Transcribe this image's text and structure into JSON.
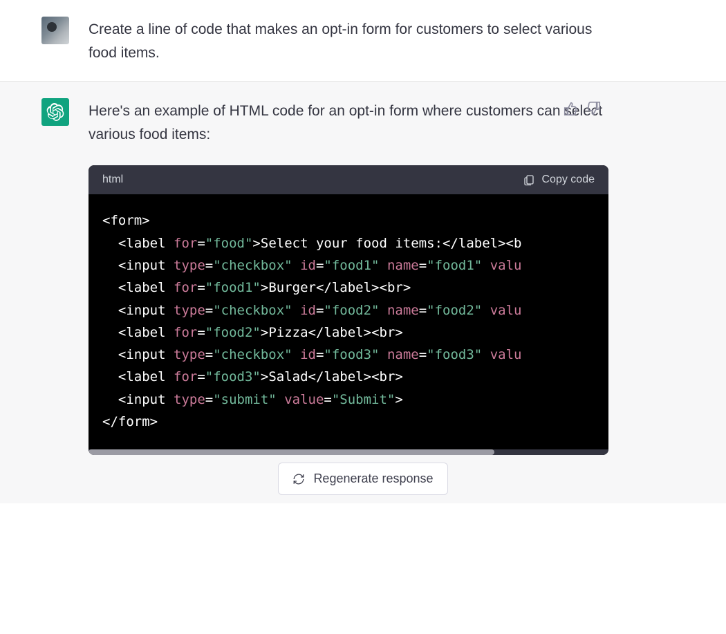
{
  "user_message": "Create a line of code that makes an opt-in form for customers to select various food items.",
  "assistant_intro": "Here's an example of HTML code for an opt-in form where customers can select various food items:",
  "code_lang_label": "html",
  "copy_label": "Copy code",
  "regenerate_label": "Regenerate response",
  "feedback_up_icon": "thumb-up",
  "feedback_down_icon": "thumb-down",
  "code_lines": [
    {
      "indent": 0,
      "parts": [
        {
          "t": "punc",
          "v": "<"
        },
        {
          "t": "tag",
          "v": "form"
        },
        {
          "t": "punc",
          "v": ">"
        }
      ]
    },
    {
      "indent": 1,
      "parts": [
        {
          "t": "punc",
          "v": "<"
        },
        {
          "t": "tag",
          "v": "label"
        },
        {
          "t": "text",
          "v": " "
        },
        {
          "t": "attr",
          "v": "for"
        },
        {
          "t": "eq",
          "v": "="
        },
        {
          "t": "str",
          "v": "\"food\""
        },
        {
          "t": "punc",
          "v": ">"
        },
        {
          "t": "text",
          "v": "Select your food items:"
        },
        {
          "t": "punc",
          "v": "</"
        },
        {
          "t": "tag",
          "v": "label"
        },
        {
          "t": "punc",
          "v": ">"
        },
        {
          "t": "punc",
          "v": "<"
        },
        {
          "t": "tag",
          "v": "b"
        }
      ]
    },
    {
      "indent": 1,
      "parts": [
        {
          "t": "punc",
          "v": "<"
        },
        {
          "t": "tag",
          "v": "input"
        },
        {
          "t": "text",
          "v": " "
        },
        {
          "t": "attr",
          "v": "type"
        },
        {
          "t": "eq",
          "v": "="
        },
        {
          "t": "str",
          "v": "\"checkbox\""
        },
        {
          "t": "text",
          "v": " "
        },
        {
          "t": "attr",
          "v": "id"
        },
        {
          "t": "eq",
          "v": "="
        },
        {
          "t": "str",
          "v": "\"food1\""
        },
        {
          "t": "text",
          "v": " "
        },
        {
          "t": "attr",
          "v": "name"
        },
        {
          "t": "eq",
          "v": "="
        },
        {
          "t": "str",
          "v": "\"food1\""
        },
        {
          "t": "text",
          "v": " "
        },
        {
          "t": "attr",
          "v": "valu"
        }
      ]
    },
    {
      "indent": 1,
      "parts": [
        {
          "t": "punc",
          "v": "<"
        },
        {
          "t": "tag",
          "v": "label"
        },
        {
          "t": "text",
          "v": " "
        },
        {
          "t": "attr",
          "v": "for"
        },
        {
          "t": "eq",
          "v": "="
        },
        {
          "t": "str",
          "v": "\"food1\""
        },
        {
          "t": "punc",
          "v": ">"
        },
        {
          "t": "text",
          "v": "Burger"
        },
        {
          "t": "punc",
          "v": "</"
        },
        {
          "t": "tag",
          "v": "label"
        },
        {
          "t": "punc",
          "v": ">"
        },
        {
          "t": "punc",
          "v": "<"
        },
        {
          "t": "tag",
          "v": "br"
        },
        {
          "t": "punc",
          "v": ">"
        }
      ]
    },
    {
      "indent": 1,
      "parts": [
        {
          "t": "punc",
          "v": "<"
        },
        {
          "t": "tag",
          "v": "input"
        },
        {
          "t": "text",
          "v": " "
        },
        {
          "t": "attr",
          "v": "type"
        },
        {
          "t": "eq",
          "v": "="
        },
        {
          "t": "str",
          "v": "\"checkbox\""
        },
        {
          "t": "text",
          "v": " "
        },
        {
          "t": "attr",
          "v": "id"
        },
        {
          "t": "eq",
          "v": "="
        },
        {
          "t": "str",
          "v": "\"food2\""
        },
        {
          "t": "text",
          "v": " "
        },
        {
          "t": "attr",
          "v": "name"
        },
        {
          "t": "eq",
          "v": "="
        },
        {
          "t": "str",
          "v": "\"food2\""
        },
        {
          "t": "text",
          "v": " "
        },
        {
          "t": "attr",
          "v": "valu"
        }
      ]
    },
    {
      "indent": 1,
      "parts": [
        {
          "t": "punc",
          "v": "<"
        },
        {
          "t": "tag",
          "v": "label"
        },
        {
          "t": "text",
          "v": " "
        },
        {
          "t": "attr",
          "v": "for"
        },
        {
          "t": "eq",
          "v": "="
        },
        {
          "t": "str",
          "v": "\"food2\""
        },
        {
          "t": "punc",
          "v": ">"
        },
        {
          "t": "text",
          "v": "Pizza"
        },
        {
          "t": "punc",
          "v": "</"
        },
        {
          "t": "tag",
          "v": "label"
        },
        {
          "t": "punc",
          "v": ">"
        },
        {
          "t": "punc",
          "v": "<"
        },
        {
          "t": "tag",
          "v": "br"
        },
        {
          "t": "punc",
          "v": ">"
        }
      ]
    },
    {
      "indent": 1,
      "parts": [
        {
          "t": "punc",
          "v": "<"
        },
        {
          "t": "tag",
          "v": "input"
        },
        {
          "t": "text",
          "v": " "
        },
        {
          "t": "attr",
          "v": "type"
        },
        {
          "t": "eq",
          "v": "="
        },
        {
          "t": "str",
          "v": "\"checkbox\""
        },
        {
          "t": "text",
          "v": " "
        },
        {
          "t": "attr",
          "v": "id"
        },
        {
          "t": "eq",
          "v": "="
        },
        {
          "t": "str",
          "v": "\"food3\""
        },
        {
          "t": "text",
          "v": " "
        },
        {
          "t": "attr",
          "v": "name"
        },
        {
          "t": "eq",
          "v": "="
        },
        {
          "t": "str",
          "v": "\"food3\""
        },
        {
          "t": "text",
          "v": " "
        },
        {
          "t": "attr",
          "v": "valu"
        }
      ]
    },
    {
      "indent": 1,
      "parts": [
        {
          "t": "punc",
          "v": "<"
        },
        {
          "t": "tag",
          "v": "label"
        },
        {
          "t": "text",
          "v": " "
        },
        {
          "t": "attr",
          "v": "for"
        },
        {
          "t": "eq",
          "v": "="
        },
        {
          "t": "str",
          "v": "\"food3\""
        },
        {
          "t": "punc",
          "v": ">"
        },
        {
          "t": "text",
          "v": "Salad"
        },
        {
          "t": "punc",
          "v": "</"
        },
        {
          "t": "tag",
          "v": "label"
        },
        {
          "t": "punc",
          "v": ">"
        },
        {
          "t": "punc",
          "v": "<"
        },
        {
          "t": "tag",
          "v": "br"
        },
        {
          "t": "punc",
          "v": ">"
        }
      ]
    },
    {
      "indent": 1,
      "parts": [
        {
          "t": "punc",
          "v": "<"
        },
        {
          "t": "tag",
          "v": "input"
        },
        {
          "t": "text",
          "v": " "
        },
        {
          "t": "attr",
          "v": "type"
        },
        {
          "t": "eq",
          "v": "="
        },
        {
          "t": "str",
          "v": "\"submit\""
        },
        {
          "t": "text",
          "v": " "
        },
        {
          "t": "attr",
          "v": "value"
        },
        {
          "t": "eq",
          "v": "="
        },
        {
          "t": "str",
          "v": "\"Submit\""
        },
        {
          "t": "punc",
          "v": ">"
        }
      ]
    },
    {
      "indent": 0,
      "parts": [
        {
          "t": "punc",
          "v": "</"
        },
        {
          "t": "tag",
          "v": "form"
        },
        {
          "t": "punc",
          "v": ">"
        }
      ]
    }
  ]
}
